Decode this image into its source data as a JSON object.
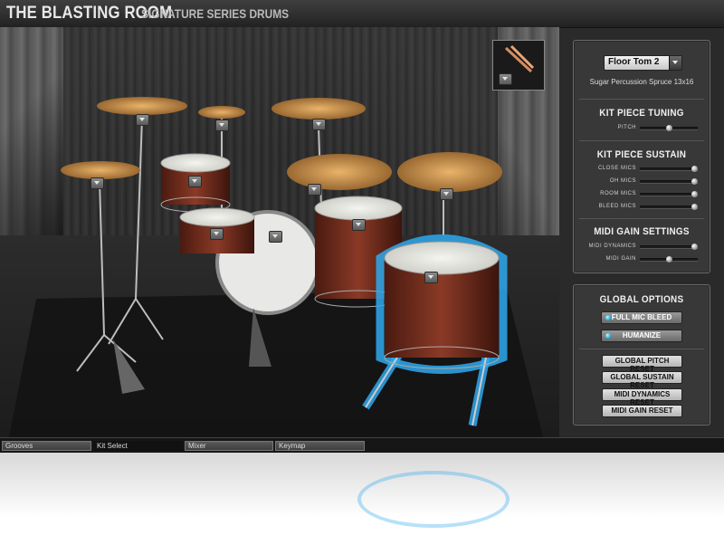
{
  "header": {
    "brand": "THE BLASTING ROOM",
    "series": "SIGNATURE SERIES DRUMS"
  },
  "kit_piece": {
    "selected": "Floor Tom 2",
    "description": "Sugar Percussion Spruce 13x16"
  },
  "tuning": {
    "title": "KIT PIECE TUNING",
    "controls": [
      {
        "label": "PITCH",
        "value": 0.5
      }
    ]
  },
  "sustain": {
    "title": "KIT PIECE SUSTAIN",
    "controls": [
      {
        "label": "CLOSE MICS",
        "value": 0.95
      },
      {
        "label": "OH MICS",
        "value": 0.95
      },
      {
        "label": "ROOM MICS",
        "value": 0.95
      },
      {
        "label": "BLEED MICS",
        "value": 0.95
      }
    ]
  },
  "midi_gain": {
    "title": "MIDI GAIN SETTINGS",
    "controls": [
      {
        "label": "MIDI DYNAMICS",
        "value": 0.95
      },
      {
        "label": "MIDI GAIN",
        "value": 0.5
      }
    ]
  },
  "global": {
    "title": "GLOBAL OPTIONS",
    "toggles": [
      "FULL MIC BLEED",
      "HUMANIZE"
    ],
    "resets": [
      "GLOBAL PITCH RESET",
      "GLOBAL SUSTAIN RESET",
      "MIDI DYNAMICS RESET",
      "MIDI GAIN RESET"
    ]
  },
  "tabs": [
    "Grooves",
    "Kit Select",
    "Mixer",
    "Keymap"
  ],
  "colors": {
    "highlight": "#2ea9ee",
    "shell": "#7a2e1f"
  }
}
